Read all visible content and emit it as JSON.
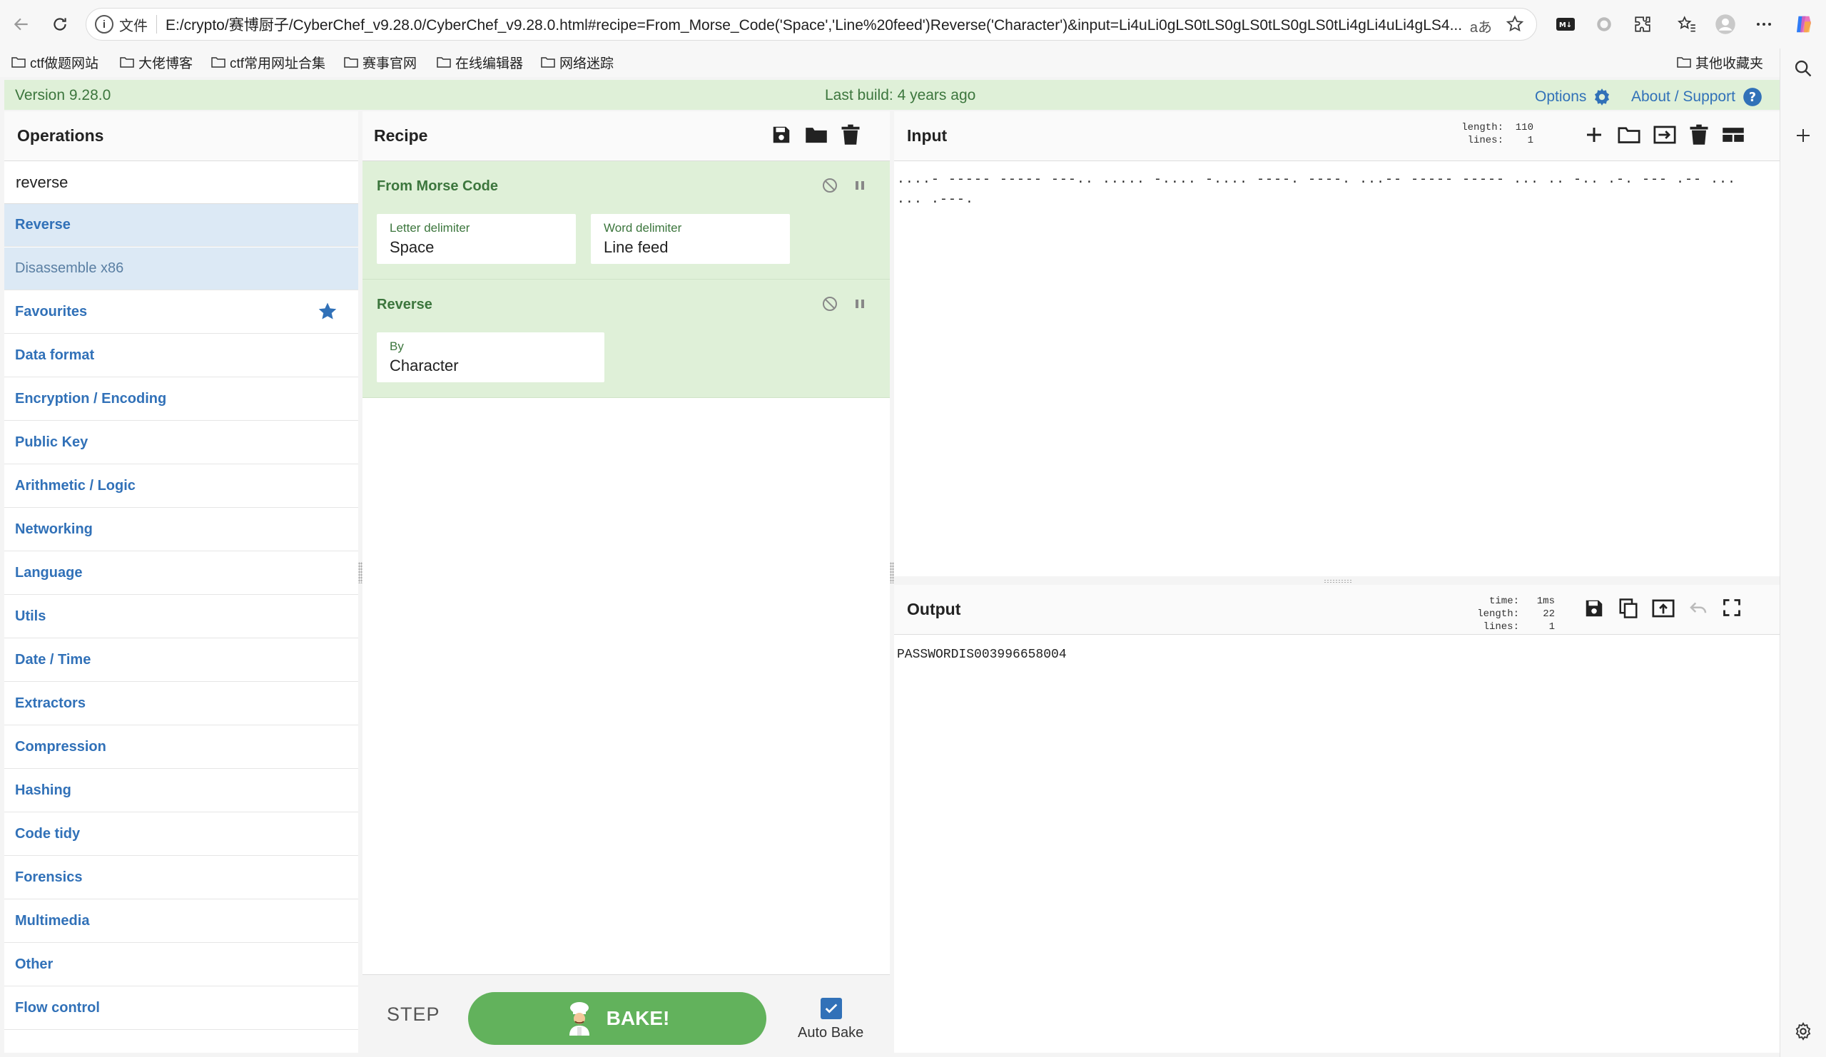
{
  "browser": {
    "file_label": "文件",
    "url": "E:/crypto/赛博厨子/CyberChef_v9.28.0/CyberChef_v9.28.0.html#recipe=From_Morse_Code('Space','Line%20feed')Reverse('Character')&input=Li4uLi0gLS0tLS0gLS0tLS0gLS0tLi4gLi4uLi4gLS4uLi4gLS4uLi4gLS0tLS4gLS0tLS4gLi4uLS0gLS0tLS0gLS0tLS0gLi4uIC4uIC0uLiAuLS4gLS0tIC4tLSAuLi4gLi4uIC4tLS0u",
    "url_display": "E:/crypto/赛博厨子/CyberChef_v9.28.0/CyberChef_v9.28.0.html#recipe=From_Morse_Code('Space','Line%20feed')Reverse('Character')&input=Li4uLi0gLS0tLS0gLS0tLS0gLS0tLi4gLi4uLi4gLS4...",
    "read_aloud": "aあ",
    "bookmarks": [
      "ctf做题网站",
      "大佬博客",
      "ctf常用网址合集",
      "赛事官网",
      "在线编辑器",
      "网络迷踪"
    ],
    "other_bookmarks": "其他收藏夹",
    "colors": {
      "accent": "#1a73e8"
    }
  },
  "banner": {
    "version": "Version 9.28.0",
    "last_build": "Last build: 4 years ago",
    "options": "Options",
    "about": "About / Support"
  },
  "operations": {
    "title": "Operations",
    "search_value": "reverse",
    "results": [
      "Reverse",
      "Disassemble x86"
    ],
    "categories": [
      "Favourites",
      "Data format",
      "Encryption / Encoding",
      "Public Key",
      "Arithmetic / Logic",
      "Networking",
      "Language",
      "Utils",
      "Date / Time",
      "Extractors",
      "Compression",
      "Hashing",
      "Code tidy",
      "Forensics",
      "Multimedia",
      "Other",
      "Flow control"
    ]
  },
  "recipe": {
    "title": "Recipe",
    "ops": [
      {
        "name": "From Morse Code",
        "args": [
          {
            "label": "Letter delimiter",
            "value": "Space"
          },
          {
            "label": "Word delimiter",
            "value": "Line feed"
          }
        ]
      },
      {
        "name": "Reverse",
        "args": [
          {
            "label": "By",
            "value": "Character"
          }
        ]
      }
    ],
    "step_label": "STEP",
    "bake_label": "BAKE!",
    "auto_bake_label": "Auto Bake",
    "auto_bake_checked": true
  },
  "input": {
    "title": "Input",
    "length_label": "length:",
    "length": "110",
    "lines_label": "lines:",
    "lines": "1",
    "text": "....- ----- ----- ---.. ..... -.... -.... ----. ----. ...-- ----- ----- ... .. -.. .-. --- .-- ... ... .---."
  },
  "output": {
    "title": "Output",
    "time_label": "time:",
    "time": "1ms",
    "length_label": "length:",
    "length": "22",
    "lines_label": "lines:",
    "lines": "1",
    "text": "PASSWORDIS003996658004"
  },
  "colors": {
    "banner_bg": "#dff0d8",
    "banner_text": "#3c763d",
    "link": "#3171b8",
    "recipe_op_bg": "#dff0d8",
    "search_result_bg": "#dce9f5",
    "bake_green": "#62b25c"
  },
  "icons": {
    "toolbar": [
      "back-icon",
      "reload-icon",
      "info-icon",
      "star-icon",
      "markdown-icon",
      "circle-icon",
      "extensions-icon",
      "favorites-icon",
      "profile-icon",
      "more-icon",
      "copilot-icon"
    ],
    "recipe": [
      "save-icon",
      "folder-icon",
      "trash-icon",
      "disable-icon",
      "pause-icon"
    ],
    "input": [
      "plus-icon",
      "folder-icon",
      "import-icon",
      "trash-icon",
      "layout-icon"
    ],
    "output": [
      "save-icon",
      "copy-icon",
      "replace-input-icon",
      "undo-icon",
      "maximize-icon"
    ],
    "rail": [
      "search-icon",
      "plus-icon",
      "settings-icon"
    ]
  }
}
